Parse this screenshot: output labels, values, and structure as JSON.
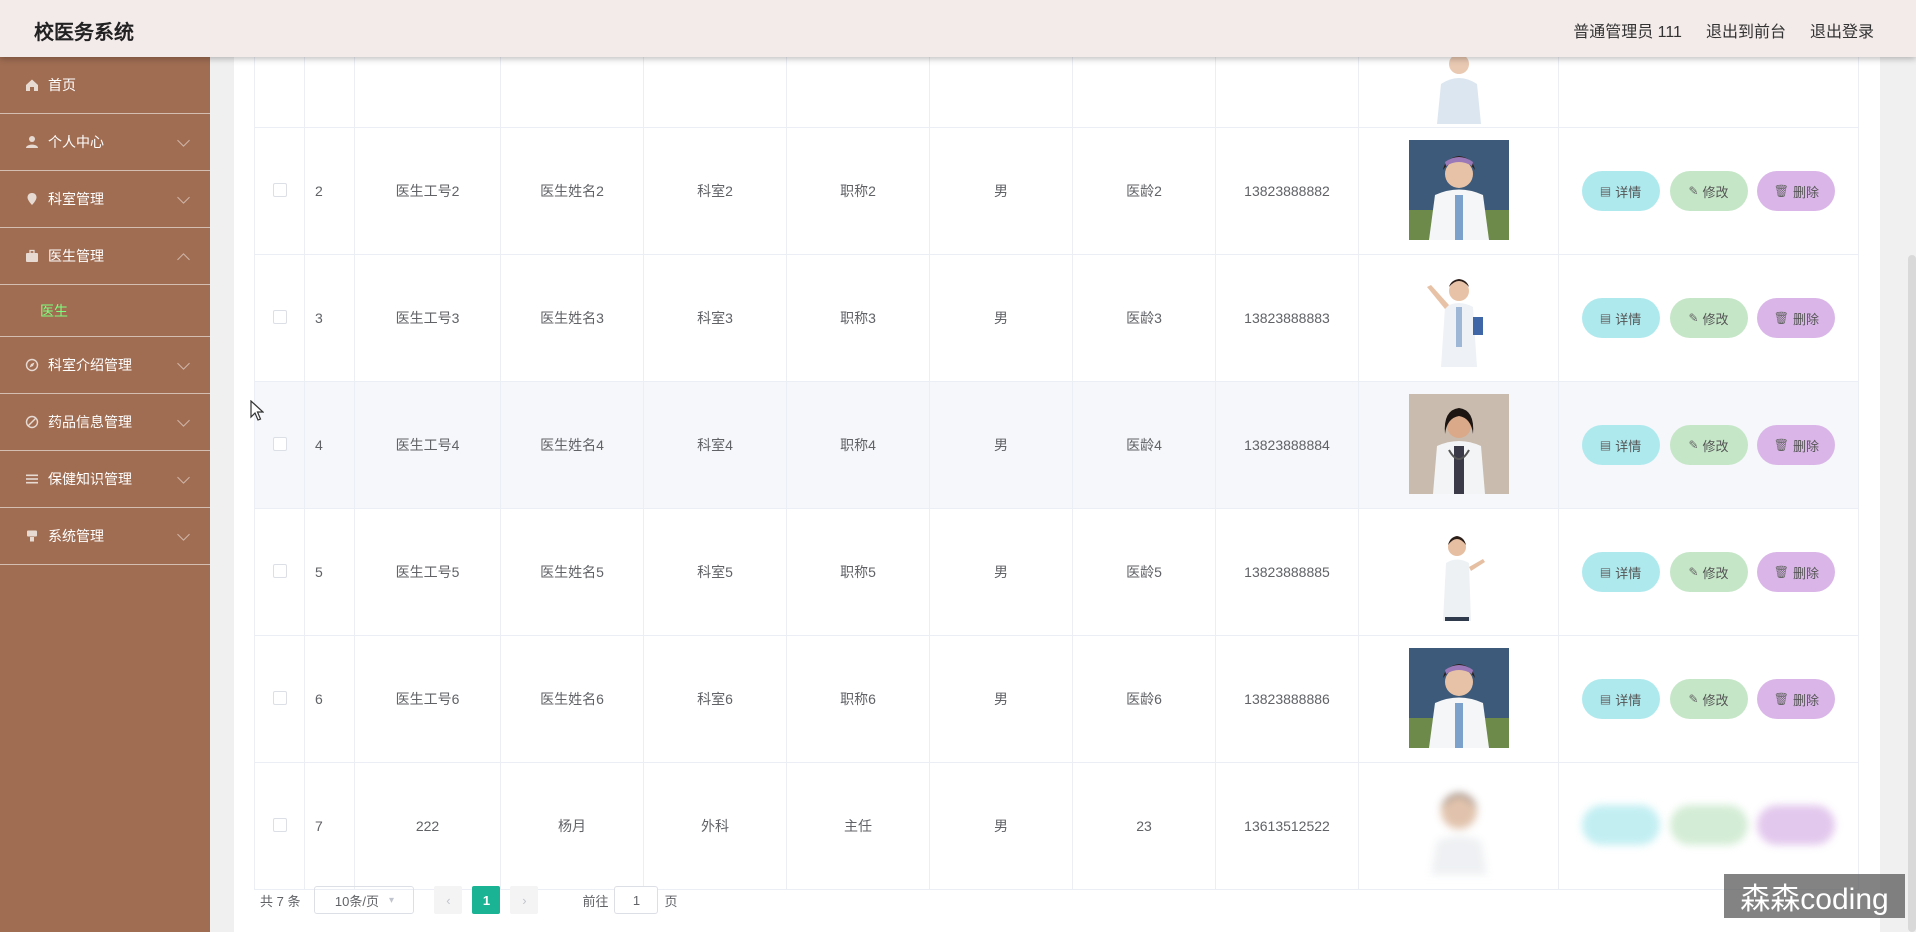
{
  "header": {
    "title": "校医务系统",
    "user": "普通管理员 111",
    "front_link": "退出到前台",
    "logout_link": "退出登录"
  },
  "sidebar": {
    "items": [
      {
        "label": "首页",
        "icon": "home-icon"
      },
      {
        "label": "个人中心",
        "icon": "user-icon"
      },
      {
        "label": "科室管理",
        "icon": "location-icon"
      },
      {
        "label": "医生管理",
        "icon": "briefcase-icon"
      },
      {
        "label": "科室介绍管理",
        "icon": "compass-icon"
      },
      {
        "label": "药品信息管理",
        "icon": "pill-icon"
      },
      {
        "label": "保健知识管理",
        "icon": "list-icon"
      },
      {
        "label": "系统管理",
        "icon": "settings-icon"
      }
    ],
    "submenu": {
      "label": "医生"
    }
  },
  "table": {
    "rows": [
      {
        "index": "2",
        "id": "医生工号2",
        "name": "医生姓名2",
        "dept": "科室2",
        "title": "职称2",
        "gender": "男",
        "age": "医龄2",
        "phone": "13823888882"
      },
      {
        "index": "3",
        "id": "医生工号3",
        "name": "医生姓名3",
        "dept": "科室3",
        "title": "职称3",
        "gender": "男",
        "age": "医龄3",
        "phone": "13823888883"
      },
      {
        "index": "4",
        "id": "医生工号4",
        "name": "医生姓名4",
        "dept": "科室4",
        "title": "职称4",
        "gender": "男",
        "age": "医龄4",
        "phone": "13823888884"
      },
      {
        "index": "5",
        "id": "医生工号5",
        "name": "医生姓名5",
        "dept": "科室5",
        "title": "职称5",
        "gender": "男",
        "age": "医龄5",
        "phone": "13823888885"
      },
      {
        "index": "6",
        "id": "医生工号6",
        "name": "医生姓名6",
        "dept": "科室6",
        "title": "职称6",
        "gender": "男",
        "age": "医龄6",
        "phone": "13823888886"
      },
      {
        "index": "7",
        "id": "222",
        "name": "杨月",
        "dept": "外科",
        "title": "主任",
        "gender": "男",
        "age": "23",
        "phone": "13613512522"
      }
    ],
    "actions": {
      "detail": "详情",
      "edit": "修改",
      "delete": "删除"
    }
  },
  "pagination": {
    "total": "共 7 条",
    "page_size": "10条/页",
    "current_page": "1",
    "goto_prefix": "前往",
    "goto_value": "1",
    "goto_suffix": "页"
  },
  "watermark": "森森coding",
  "colors": {
    "sidebar": "#a06d52",
    "submenu_active": "#7fff7f",
    "page_active": "#1ab394",
    "btn_detail": "#aee9ee",
    "btn_edit": "#c5e6c7",
    "btn_delete": "#d9b6e7"
  }
}
